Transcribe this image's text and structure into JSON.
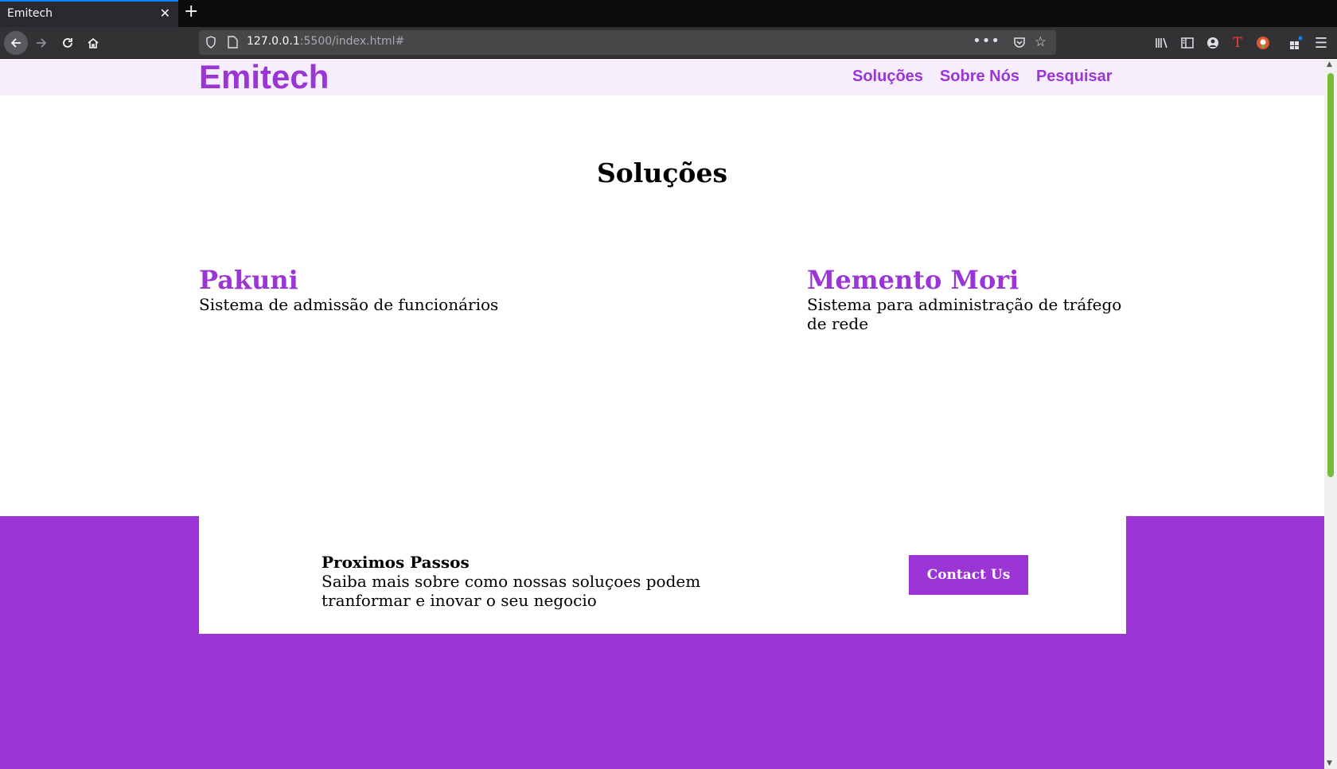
{
  "browser": {
    "tab_title": "Emitech",
    "tab_close": "✕",
    "new_tab": "+",
    "url_host": "127.0.0.1",
    "url_rest": ":5500/index.html#",
    "more_dots": "•••",
    "star": "☆",
    "menu": "☰",
    "extension_letter": "T",
    "colors": {
      "tab_accent": "#0a84ff",
      "scrollbar_thumb": "#7bb93b"
    }
  },
  "site": {
    "logo": "Emitech",
    "nav": [
      "Soluções",
      "Sobre Nós",
      "Pesquisar"
    ],
    "section_title": "Soluções",
    "solutions": [
      {
        "name": "Pakuni",
        "description": "Sistema de admissão de funcionários"
      },
      {
        "name": "Memento Mori",
        "description": "Sistema para administração de tráfego de rede"
      }
    ],
    "cta": {
      "title": "Proximos Passos",
      "description": "Saiba mais sobre como nossas soluçoes podem tranformar e inovar o seu negocio",
      "button": "Contact Us"
    },
    "colors": {
      "brand": "#9b35d6",
      "header_bg": "#f6eefc"
    }
  }
}
